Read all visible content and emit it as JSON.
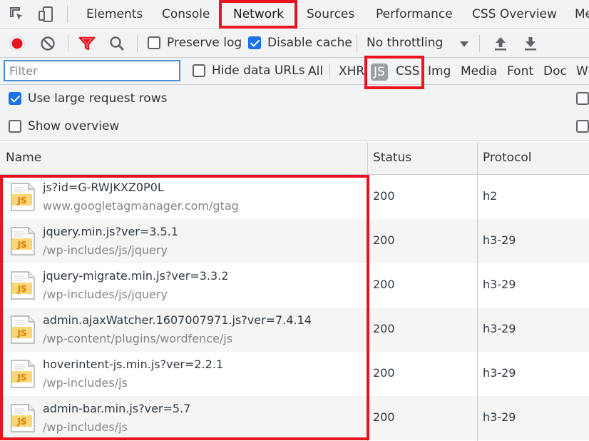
{
  "tabs": [
    "Elements",
    "Console",
    "Network",
    "Sources",
    "Performance",
    "CSS Overview",
    "Me"
  ],
  "toolbar": {
    "preserve_log": "Preserve log",
    "disable_cache": "Disable cache",
    "throttling": "No throttling"
  },
  "filter": {
    "placeholder": "Filter",
    "hide_data_urls": "Hide data URLs",
    "types": [
      "All",
      "XHR",
      "JS",
      "CSS",
      "Img",
      "Media",
      "Font",
      "Doc",
      "WS"
    ],
    "selected_type": "JS"
  },
  "options": {
    "large_rows": "Use large request rows",
    "show_overview": "Show overview"
  },
  "table": {
    "headers": [
      "Name",
      "Status",
      "Protocol"
    ],
    "rows": [
      {
        "name": "js?id=G-RWJKXZ0P0L",
        "path": "www.googletagmanager.com/gtag",
        "status": "200",
        "protocol": "h2"
      },
      {
        "name": "jquery.min.js?ver=3.5.1",
        "path": "/wp-includes/js/jquery",
        "status": "200",
        "protocol": "h3-29"
      },
      {
        "name": "jquery-migrate.min.js?ver=3.3.2",
        "path": "/wp-includes/js/jquery",
        "status": "200",
        "protocol": "h3-29"
      },
      {
        "name": "admin.ajaxWatcher.1607007971.js?ver=7.4.14",
        "path": "/wp-content/plugins/wordfence/js",
        "status": "200",
        "protocol": "h3-29"
      },
      {
        "name": "hoverintent-js.min.js?ver=2.2.1",
        "path": "/wp-includes/js",
        "status": "200",
        "protocol": "h3-29"
      },
      {
        "name": "admin-bar.min.js?ver=5.7",
        "path": "/wp-includes/js",
        "status": "200",
        "protocol": "h3-29"
      }
    ]
  },
  "icons": {
    "file_icon_label": "JS"
  },
  "colors": {
    "highlight": "#e8141e",
    "record": "#e8141e",
    "accent": "#1a73e8"
  }
}
